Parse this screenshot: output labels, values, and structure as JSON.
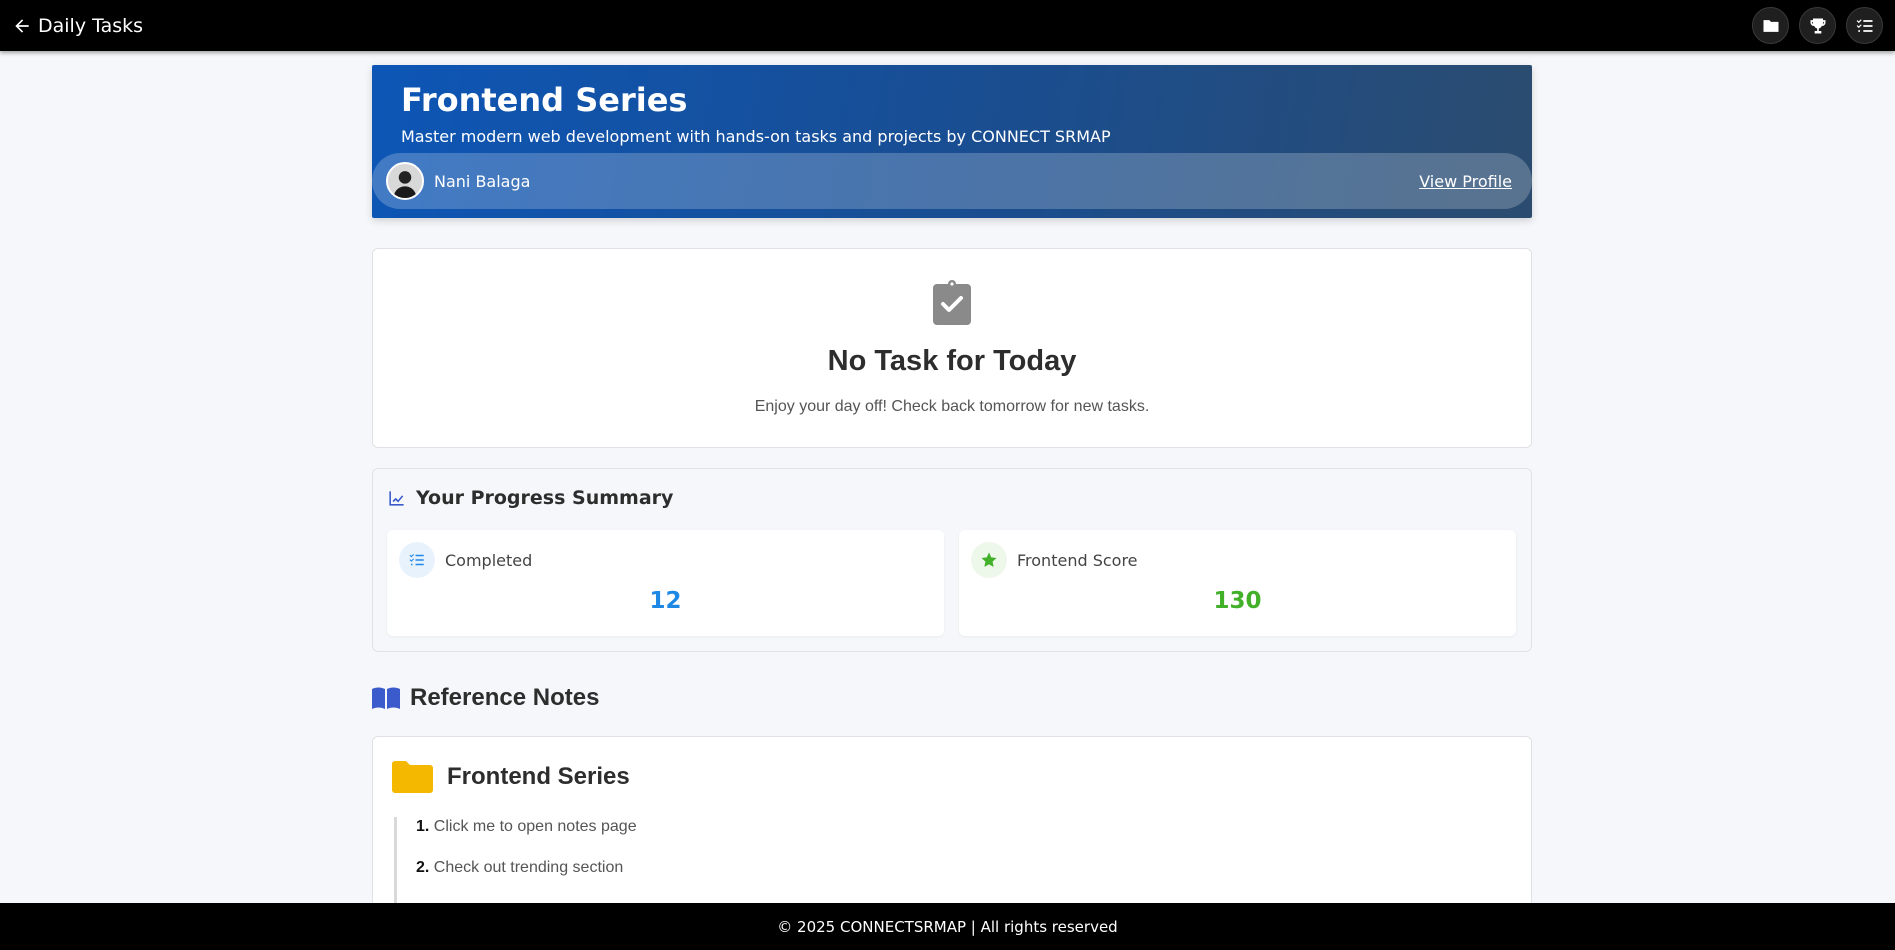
{
  "topbar": {
    "back_label": "Daily Tasks",
    "icons": [
      "folder-icon",
      "trophy-icon",
      "tasks-icon"
    ]
  },
  "hero": {
    "title": "Frontend Series",
    "subtitle": "Master modern web development with hands-on tasks and projects by CONNECT SRMAP",
    "user_name": "Nani Balaga",
    "view_profile_label": "View Profile"
  },
  "today": {
    "title": "No Task for Today",
    "message": "Enjoy your day off! Check back tomorrow for new tasks."
  },
  "progress": {
    "title": "Your Progress Summary",
    "stats": [
      {
        "label": "Completed",
        "value": "12",
        "color": "#1e88e5",
        "icon": "list-check-icon"
      },
      {
        "label": "Frontend Score",
        "value": "130",
        "color": "#43b02a",
        "icon": "star-icon"
      }
    ]
  },
  "reference": {
    "title": "Reference Notes",
    "folder_title": "Frontend Series",
    "notes": [
      {
        "num": "1.",
        "text": "Click me to open notes page"
      },
      {
        "num": "2.",
        "text": "Check out trending section"
      }
    ]
  },
  "footer": {
    "text": "© 2025 CONNECTSRMAP | All rights reserved"
  },
  "colors": {
    "accent_blue": "#1e88e5",
    "accent_green": "#43b02a",
    "folder_yellow": "#f5b800",
    "hero_gradient_start": "#0d56b6"
  }
}
